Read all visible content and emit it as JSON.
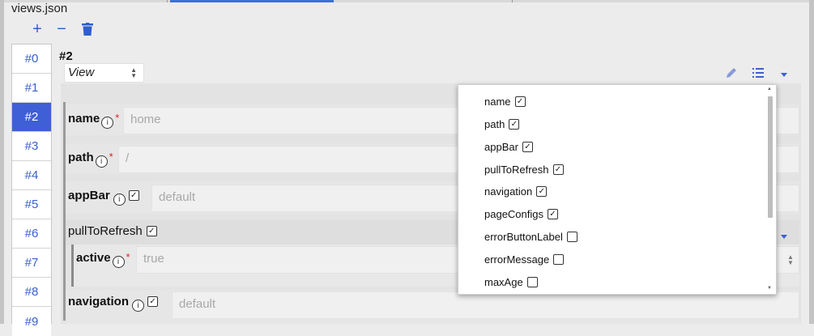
{
  "file_title": "views.json",
  "toolbar": {
    "add_icon": "plus-icon",
    "remove_icon": "minus-icon",
    "delete_icon": "trash-icon",
    "add_glyph": "+",
    "remove_glyph": "−"
  },
  "index_items": [
    "#0",
    "#1",
    "#2",
    "#3",
    "#4",
    "#5",
    "#6",
    "#7",
    "#8",
    "#9"
  ],
  "active_index": "#2",
  "detail": {
    "title": "#2",
    "type_select": "View",
    "fields": {
      "name": {
        "label": "name",
        "placeholder": "home"
      },
      "path": {
        "label": "path",
        "placeholder": "/"
      },
      "appBar": {
        "label": "appBar",
        "placeholder": "default"
      },
      "pullToRefresh": {
        "label": "pullToRefresh"
      },
      "active": {
        "label": "active",
        "placeholder": "true"
      },
      "navigation": {
        "label": "navigation",
        "placeholder": "default"
      }
    },
    "info_glyph": "i",
    "required_marker": "*",
    "checked_glyph": "✓"
  },
  "property_menu": {
    "items": [
      {
        "label": "name",
        "checked": true
      },
      {
        "label": "path",
        "checked": true
      },
      {
        "label": "appBar",
        "checked": true
      },
      {
        "label": "pullToRefresh",
        "checked": true
      },
      {
        "label": "navigation",
        "checked": true
      },
      {
        "label": "pageConfigs",
        "checked": true
      },
      {
        "label": "errorButtonLabel",
        "checked": false
      },
      {
        "label": "errorMessage",
        "checked": false
      },
      {
        "label": "maxAge",
        "checked": false
      }
    ]
  },
  "colors": {
    "accent": "#3f5fd6",
    "icon": "#2f5fcf",
    "required": "#e02020"
  }
}
